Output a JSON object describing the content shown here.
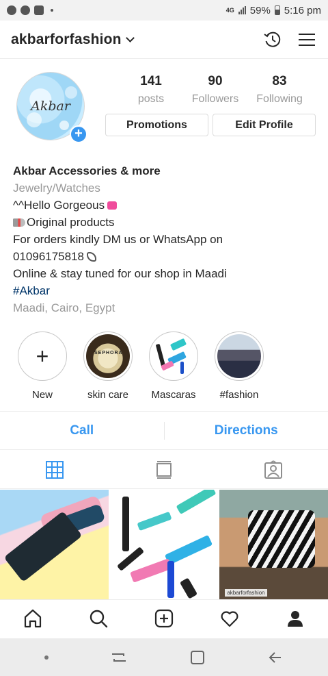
{
  "status_bar": {
    "network": "4G",
    "battery": "59%",
    "time": "5:16 pm"
  },
  "header": {
    "username": "akbarforfashion"
  },
  "profile": {
    "avatar_text": "Akbar",
    "stats": [
      {
        "value": "141",
        "label": "posts"
      },
      {
        "value": "90",
        "label": "Followers"
      },
      {
        "value": "83",
        "label": "Following"
      }
    ],
    "buttons": {
      "promotions": "Promotions",
      "edit_profile": "Edit Profile"
    }
  },
  "bio": {
    "name": "Akbar Accessories & more",
    "category": "Jewelry/Watches",
    "line1": "^^Hello Gorgeous",
    "line2": "Original products",
    "line3": "For orders kindly DM us or WhatsApp on",
    "line4": "01096175818",
    "line5": "Online & stay tuned for our shop in Maadi",
    "hashtag": "#Akbar",
    "location": "Maadi, Cairo, Egypt"
  },
  "highlights": [
    {
      "label": "New",
      "icon": "plus-icon"
    },
    {
      "label": "skin care",
      "overlay": "SEPHORA"
    },
    {
      "label": "Mascaras"
    },
    {
      "label": "#fashion"
    }
  ],
  "actions": {
    "call": "Call",
    "directions": "Directions"
  },
  "tabs": [
    {
      "name": "grid-icon",
      "active": true
    },
    {
      "name": "feed-icon",
      "active": false
    },
    {
      "name": "tagged-icon",
      "active": false
    }
  ],
  "grid": {
    "watermark": "akbarforfashion"
  },
  "colors": {
    "accent": "#3897f0",
    "hashtag": "#003569",
    "secondary_text": "#999999"
  }
}
